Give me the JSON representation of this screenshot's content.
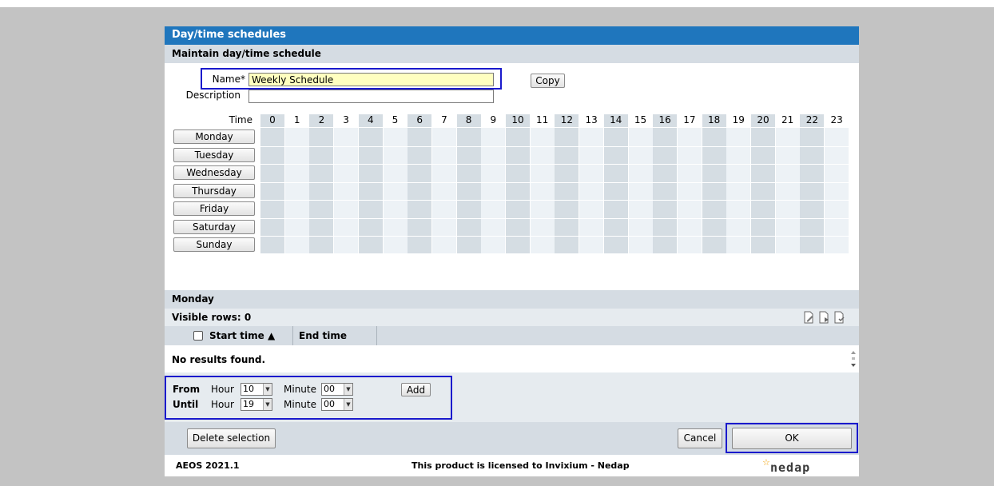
{
  "window": {
    "title": "Day/time schedules",
    "subtitle": "Maintain day/time schedule"
  },
  "form": {
    "name_label": "Name*",
    "name_value": "Weekly Schedule",
    "description_label": "Description",
    "description_value": "",
    "copy_label": "Copy"
  },
  "schedule": {
    "time_label": "Time",
    "hours": [
      "0",
      "1",
      "2",
      "3",
      "4",
      "5",
      "6",
      "7",
      "8",
      "9",
      "10",
      "11",
      "12",
      "13",
      "14",
      "15",
      "16",
      "17",
      "18",
      "19",
      "20",
      "21",
      "22",
      "23"
    ],
    "days": [
      "Monday",
      "Tuesday",
      "Wednesday",
      "Thursday",
      "Friday",
      "Saturday",
      "Sunday"
    ]
  },
  "detail": {
    "day_heading": "Monday",
    "visible_rows": "Visible rows: 0",
    "col_start": "Start time ▲",
    "col_end": "End time",
    "empty_message": "No results found.",
    "icons": [
      "edit-row-icon",
      "insert-row-icon",
      "delete-row-icon"
    ]
  },
  "time_entry": {
    "from_label": "From",
    "until_label": "Until",
    "hour_label": "Hour",
    "minute_label": "Minute",
    "from_hour": "10",
    "from_minute": "00",
    "until_hour": "19",
    "until_minute": "00",
    "add_label": "Add"
  },
  "actions": {
    "delete_label": "Delete selection",
    "cancel_label": "Cancel",
    "ok_label": "OK"
  },
  "footer": {
    "version": "AEOS 2021.1",
    "license": "This product is licensed to Invixium - Nedap",
    "brand": "nedap"
  },
  "colors": {
    "title_bar": "#1f76bd",
    "header_bar": "#d5dce3",
    "grid_shade": "#d5dde3",
    "grid_light": "#edf2f6",
    "highlight": "#1a1acc",
    "name_field": "#ffffc0",
    "brand_star": "#f0a000"
  }
}
